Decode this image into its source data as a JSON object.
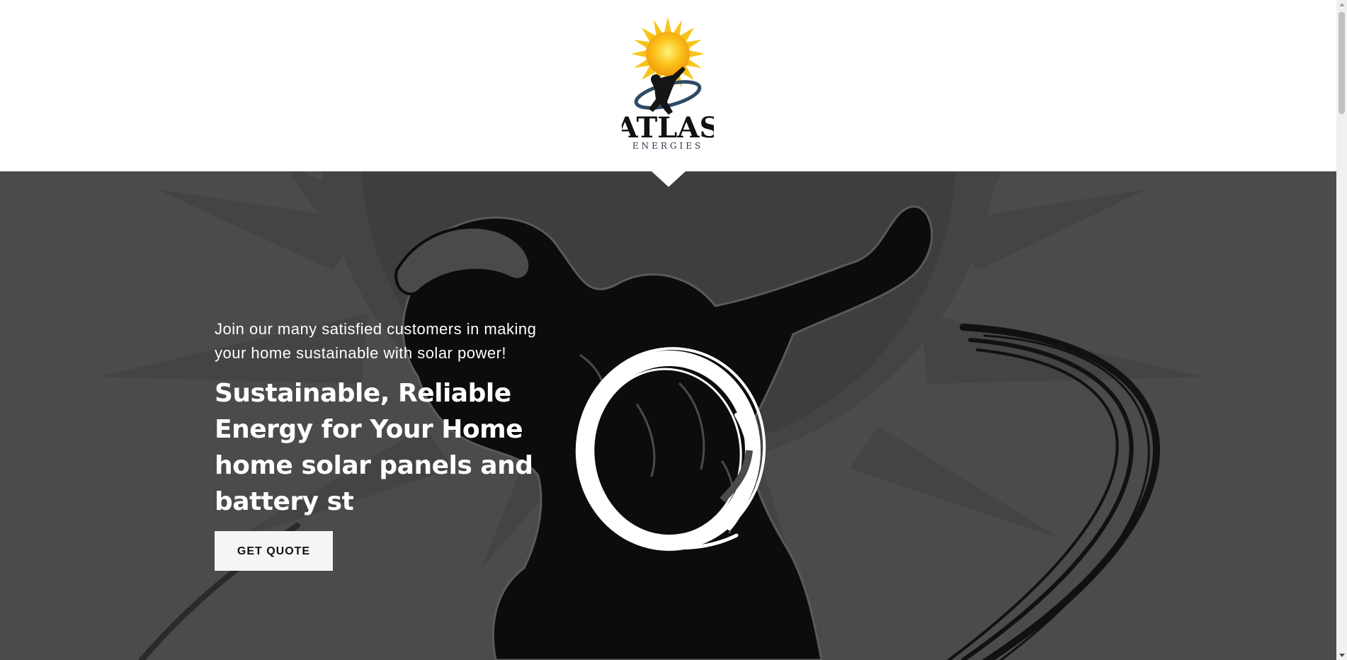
{
  "header": {
    "logo": {
      "wordmark": "ATLAS",
      "subtitle": "ENERGIES",
      "icon": "sun-atlas-logo-icon"
    }
  },
  "hero": {
    "tagline": "Join our many satisfied customers in making your home sustainable with solar power!",
    "title_lines": [
      "Sustainable, Reliable",
      "Energy for Your Home",
      "home solar panels and",
      "battery st"
    ],
    "cta_label": "GET QUOTE",
    "background_icon": "atlas-silhouette-icon",
    "ring_icon": "brush-ring-icon"
  },
  "colors": {
    "header_bg": "#ffffff",
    "hero_bg": "#4b4b4b",
    "silhouette": "#0c0c0c",
    "sun_shadow": "#3c3c3c",
    "text": "#ffffff",
    "button_bg": "#f5f5f5",
    "button_text": "#111111",
    "logo_sun": "#fbbf12"
  }
}
